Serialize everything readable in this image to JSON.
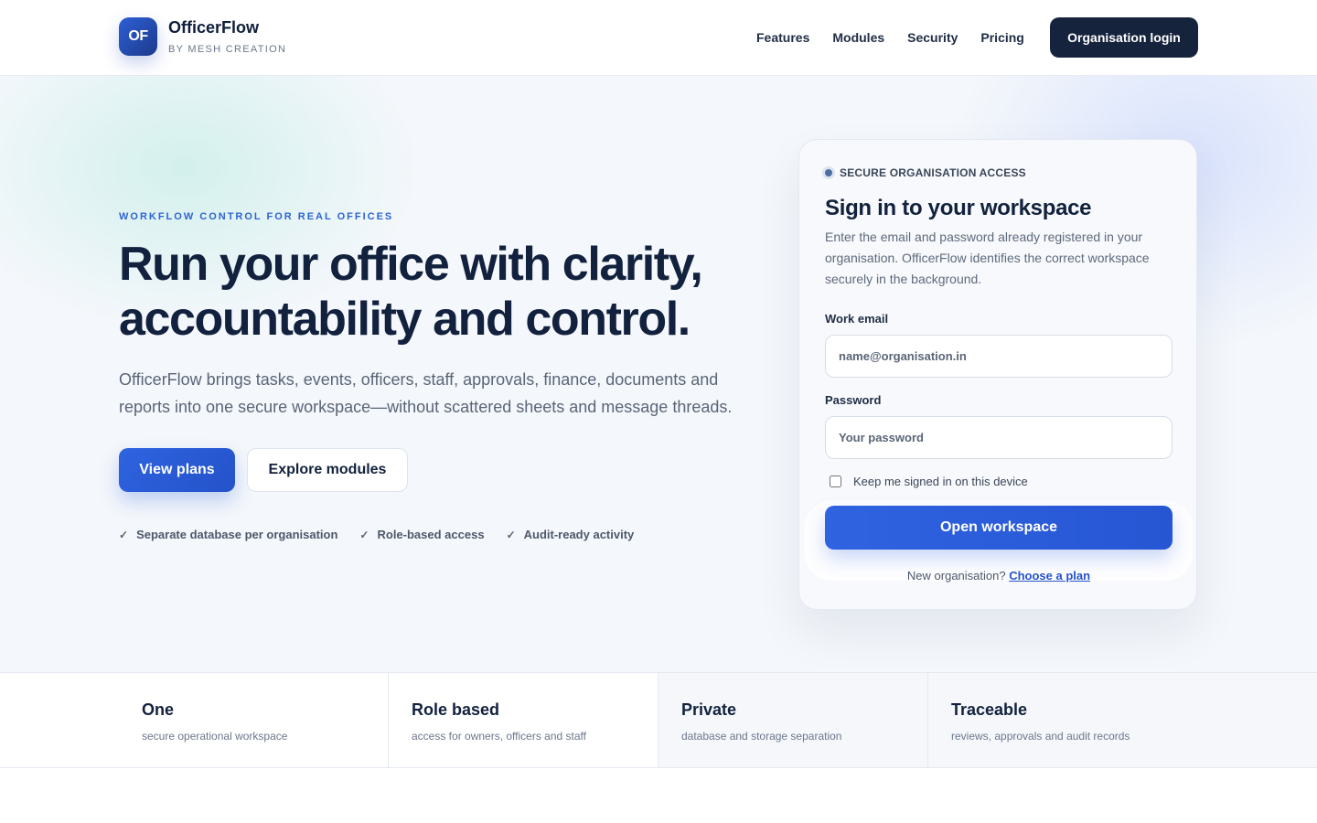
{
  "header": {
    "logo_text": "OF",
    "brand_name": "OfficerFlow",
    "brand_sub": "BY MESH CREATION",
    "nav": [
      "Features",
      "Modules",
      "Security",
      "Pricing"
    ],
    "login_label": "Organisation login"
  },
  "hero": {
    "eyebrow": "WORKFLOW CONTROL FOR REAL OFFICES",
    "headline": "Run your office with clarity, accountability and control.",
    "lead": "OfficerFlow brings tasks, events, officers, staff, approvals, finance, documents and reports into one secure workspace—without scattered sheets and message threads.",
    "primary_cta": "View plans",
    "secondary_cta": "Explore modules",
    "checks": [
      "Separate database per organisation",
      "Role-based access",
      "Audit-ready activity"
    ]
  },
  "login_card": {
    "tag": "SECURE ORGANISATION ACCESS",
    "title": "Sign in to your workspace",
    "description": "Enter the email and password already registered in your organisation. OfficerFlow identifies the correct workspace securely in the background.",
    "email_label": "Work email",
    "email_placeholder": "name@organisation.in",
    "password_label": "Password",
    "password_placeholder": "Your password",
    "remember_label": "Keep me signed in on this device",
    "submit_label": "Open workspace",
    "new_org_text": "New organisation?",
    "new_org_link": "Choose a plan"
  },
  "stats": [
    {
      "title": "One",
      "desc": "secure operational workspace"
    },
    {
      "title": "Role based",
      "desc": "access for owners, officers and staff"
    },
    {
      "title": "Private",
      "desc": "database and storage separation"
    },
    {
      "title": "Traceable",
      "desc": "reviews, approvals and audit records"
    }
  ],
  "colors": {
    "accent": "#2f63e0",
    "navy": "#16233d",
    "heading": "#12213d"
  }
}
